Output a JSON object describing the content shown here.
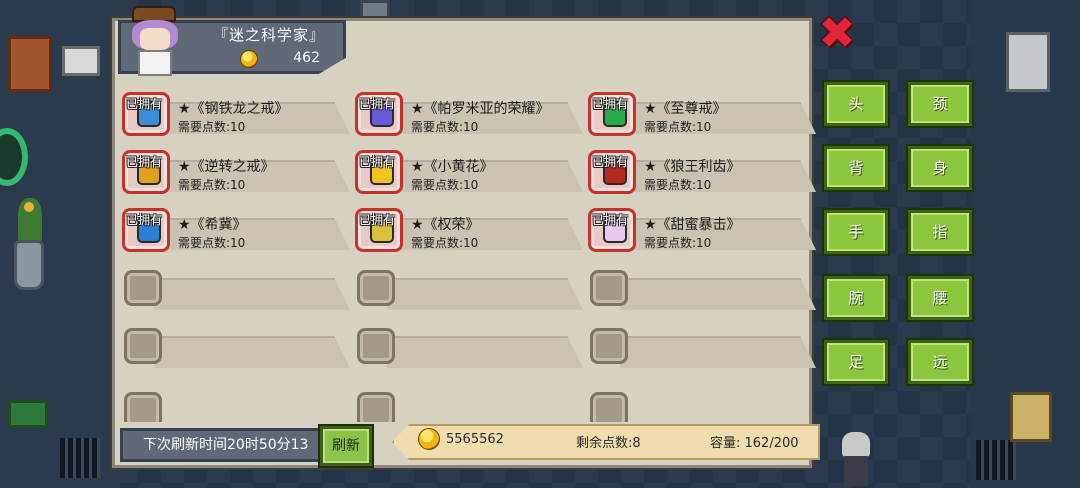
{
  "merchant": {
    "name": "『迷之科学家』",
    "coins": "462"
  },
  "close": {
    "icon": "close-x-icon",
    "color": "#e2263a"
  },
  "items": [
    {
      "name": "★《钢铁龙之戒》",
      "cost": "需要点数:10",
      "owned": "已拥有",
      "color": "#3b8fd9"
    },
    {
      "name": "★《帕罗米亚的荣耀》",
      "cost": "需要点数:10",
      "owned": "已拥有",
      "color": "#6a5cd8"
    },
    {
      "name": "★《至尊戒》",
      "cost": "需要点数:10",
      "owned": "已拥有",
      "color": "#2aa94a"
    },
    {
      "name": "★《逆转之戒》",
      "cost": "需要点数:10",
      "owned": "已拥有",
      "color": "#e0a020"
    },
    {
      "name": "★《小黄花》",
      "cost": "需要点数:10",
      "owned": "已拥有",
      "color": "#f2c21e"
    },
    {
      "name": "★《狼王利齿》",
      "cost": "需要点数:10",
      "owned": "已拥有",
      "color": "#b42a1f"
    },
    {
      "name": "★《希冀》",
      "cost": "需要点数:10",
      "owned": "已拥有",
      "color": "#2d7fd6"
    },
    {
      "name": "★《权荣》",
      "cost": "需要点数:10",
      "owned": "已拥有",
      "color": "#d9c23a"
    },
    {
      "name": "★《甜蜜暴击》",
      "cost": "需要点数:10",
      "owned": "已拥有",
      "color": "#e7c8ef"
    }
  ],
  "footer": {
    "refresh_timer": "下次刷新时间20时50分13",
    "refresh_label": "刷新",
    "gold": "5565562",
    "remaining_points": "剩余点数:8",
    "capacity": "容量:  162/200"
  },
  "categories": [
    {
      "label": "头"
    },
    {
      "label": "颈"
    },
    {
      "label": "背"
    },
    {
      "label": "身"
    },
    {
      "label": "手"
    },
    {
      "label": "指"
    },
    {
      "label": "腕"
    },
    {
      "label": "腰"
    },
    {
      "label": "足"
    },
    {
      "label": "远"
    }
  ]
}
